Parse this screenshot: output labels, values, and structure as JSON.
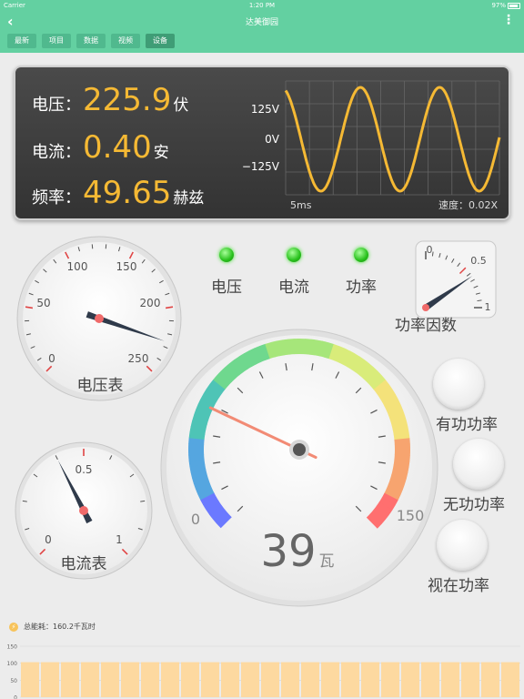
{
  "status_bar": {
    "carrier": "Carrier",
    "time": "1:20 PM",
    "battery": "97%"
  },
  "nav": {
    "title": "达美御园",
    "tabs": [
      {
        "label": "最新"
      },
      {
        "label": "项目"
      },
      {
        "label": "数据"
      },
      {
        "label": "视频"
      },
      {
        "label": "设备",
        "active": true
      }
    ]
  },
  "readings": {
    "voltage": {
      "label": "电压：",
      "value": "225.9",
      "unit": "伏"
    },
    "current": {
      "label": "电流：",
      "value": "0.40",
      "unit": "安"
    },
    "frequency": {
      "label": "频率：",
      "value": "49.65",
      "unit": "赫兹"
    }
  },
  "waveform": {
    "y_ticks": [
      "125V",
      "0V",
      "−125V"
    ],
    "time_label": "5ms",
    "speed_label": "速度：0.02X",
    "amplitude": 125,
    "cycles": 2.7,
    "wave_color": "#f5b934"
  },
  "voltmeter": {
    "label": "电压表",
    "ticks": [
      "0",
      "50",
      "100",
      "150",
      "200",
      "250"
    ],
    "value": 225.9,
    "max": 250
  },
  "ammeter": {
    "label": "电流表",
    "ticks": [
      "0",
      "0.5",
      "1"
    ],
    "value": 0.4,
    "max": 1
  },
  "indicators": [
    {
      "label": "电压"
    },
    {
      "label": "电流"
    },
    {
      "label": "功率"
    }
  ],
  "power_factor": {
    "label": "功率因数",
    "ticks": [
      "0",
      "0.5",
      "1"
    ],
    "value": 0.62
  },
  "power_gauge": {
    "value": "39",
    "unit": "瓦",
    "min_label": "0",
    "max_label": "150",
    "max": 150,
    "needle_value": 39
  },
  "power_buttons": [
    {
      "label": "有功功率"
    },
    {
      "label": "无功功率"
    },
    {
      "label": "视在功率"
    }
  ],
  "energy": {
    "label": "总能耗：",
    "value": "160.2千瓦时"
  },
  "chart_data": {
    "type": "bar",
    "y_ticks": [
      "150",
      "100",
      "50",
      "0"
    ],
    "ylim": [
      0,
      150
    ],
    "values": [
      103,
      103,
      103,
      103,
      103,
      103,
      103,
      103,
      103,
      103,
      103,
      103,
      103,
      103,
      103,
      103,
      103,
      103,
      103,
      103,
      103,
      103,
      103,
      103,
      103
    ],
    "bar_color": "#fdd9a0"
  }
}
